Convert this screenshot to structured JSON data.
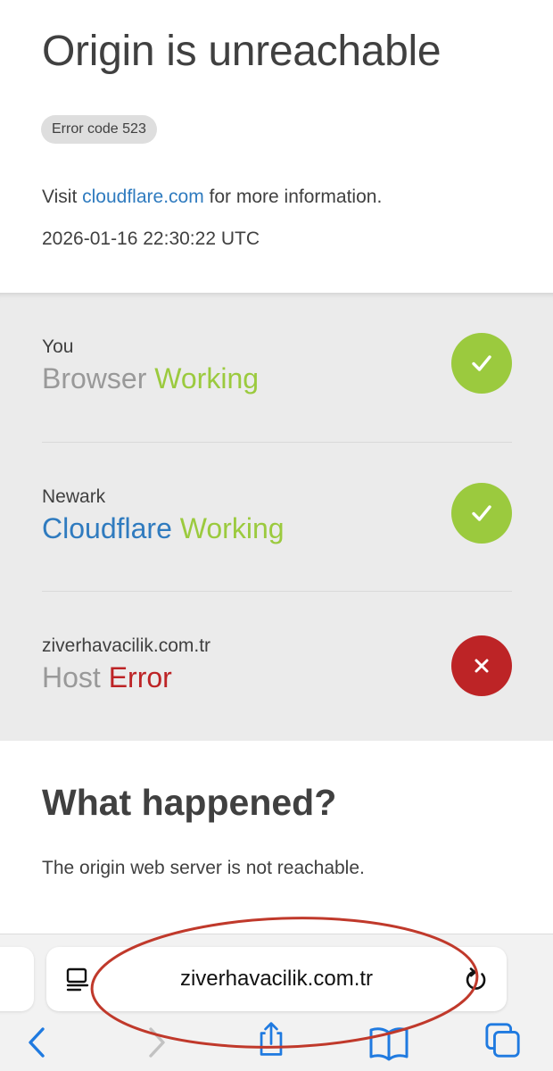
{
  "page": {
    "title": "Origin is unreachable",
    "error_badge": "Error code 523",
    "visit_prefix": "Visit ",
    "visit_link": "cloudflare.com",
    "visit_suffix": " for more information.",
    "timestamp": "2026-01-16 22:30:22 UTC"
  },
  "status": [
    {
      "location": "You",
      "kind": "Browser",
      "state": "Working",
      "result": "ok",
      "icon": "check-icon"
    },
    {
      "location": "Newark",
      "kind": "Cloudflare",
      "state": "Working",
      "result": "ok",
      "icon": "check-icon"
    },
    {
      "location": "ziverhavacilik.com.tr",
      "kind": "Host",
      "state": "Error",
      "result": "error",
      "icon": "x-icon"
    }
  ],
  "what_happened": {
    "heading": "What happened?",
    "body": "The origin web server is not reachable."
  },
  "browser": {
    "url": "ziverhavacilik.com.tr",
    "icons": [
      "reader-icon",
      "reload-icon",
      "back-icon",
      "forward-icon",
      "share-icon",
      "bookmarks-icon",
      "tabs-icon"
    ]
  },
  "colors": {
    "link_blue": "#2f7bbf",
    "ok_green": "#9bca3e",
    "error_red": "#bd2426",
    "annotation_red": "#c0392b"
  }
}
